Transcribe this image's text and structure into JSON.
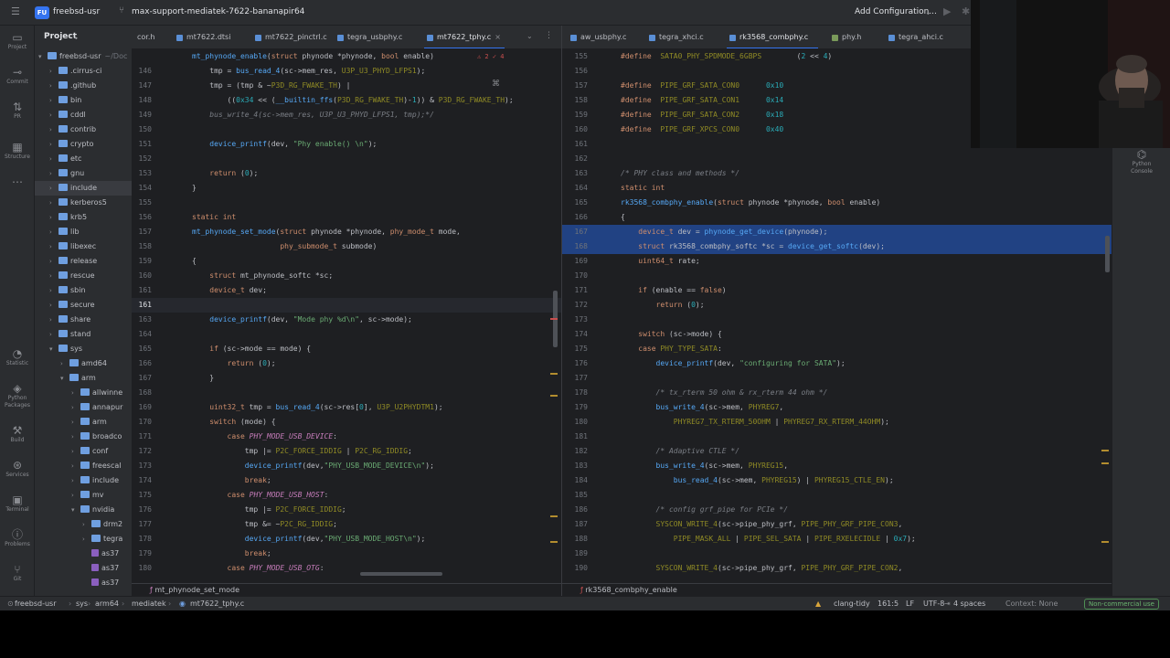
{
  "titlebar": {
    "logo": "FU",
    "project": "freebsd-usr",
    "branch": "max-support-mediatek-7622-bananapir64",
    "run_config": "Add Configuration..."
  },
  "leftstrip": {
    "items": [
      {
        "icon": "folder-icon",
        "label": "Project"
      },
      {
        "icon": "commit-icon",
        "label": "Commit"
      },
      {
        "icon": "pull-request-icon",
        "label": "PR"
      },
      {
        "icon": "structure-icon",
        "label": "Structure"
      },
      {
        "icon": "more-icon",
        "label": ""
      },
      {
        "icon": "statistic-icon",
        "label": "Statistic"
      },
      {
        "icon": "python-packages-icon",
        "label": "Python Packages"
      },
      {
        "icon": "build-icon",
        "label": "Build"
      },
      {
        "icon": "services-icon",
        "label": "Services"
      },
      {
        "icon": "terminal-icon",
        "label": "Terminal"
      },
      {
        "icon": "problems-icon",
        "label": "Problems"
      },
      {
        "icon": "git-icon",
        "label": "Git"
      }
    ]
  },
  "project_panel": {
    "title": "Project",
    "tree": [
      {
        "label": "freebsd-usr",
        "depth": 0,
        "kind": "folder",
        "open": true,
        "suffix": "~/Doc"
      },
      {
        "label": ".cirrus-ci",
        "depth": 1,
        "kind": "folder"
      },
      {
        "label": ".github",
        "depth": 1,
        "kind": "folder"
      },
      {
        "label": "bin",
        "depth": 1,
        "kind": "folder"
      },
      {
        "label": "cddl",
        "depth": 1,
        "kind": "folder"
      },
      {
        "label": "contrib",
        "depth": 1,
        "kind": "folder"
      },
      {
        "label": "crypto",
        "depth": 1,
        "kind": "folder"
      },
      {
        "label": "etc",
        "depth": 1,
        "kind": "folder"
      },
      {
        "label": "gnu",
        "depth": 1,
        "kind": "folder"
      },
      {
        "label": "include",
        "depth": 1,
        "kind": "folder",
        "selected": true
      },
      {
        "label": "kerberos5",
        "depth": 1,
        "kind": "folder"
      },
      {
        "label": "krb5",
        "depth": 1,
        "kind": "folder"
      },
      {
        "label": "lib",
        "depth": 1,
        "kind": "folder"
      },
      {
        "label": "libexec",
        "depth": 1,
        "kind": "folder"
      },
      {
        "label": "release",
        "depth": 1,
        "kind": "folder"
      },
      {
        "label": "rescue",
        "depth": 1,
        "kind": "folder"
      },
      {
        "label": "sbin",
        "depth": 1,
        "kind": "folder"
      },
      {
        "label": "secure",
        "depth": 1,
        "kind": "folder"
      },
      {
        "label": "share",
        "depth": 1,
        "kind": "folder"
      },
      {
        "label": "stand",
        "depth": 1,
        "kind": "folder"
      },
      {
        "label": "sys",
        "depth": 1,
        "kind": "folder",
        "open": true
      },
      {
        "label": "amd64",
        "depth": 2,
        "kind": "folder"
      },
      {
        "label": "arm",
        "depth": 2,
        "kind": "folder",
        "open": true
      },
      {
        "label": "allwinne",
        "depth": 3,
        "kind": "folder"
      },
      {
        "label": "annapur",
        "depth": 3,
        "kind": "folder"
      },
      {
        "label": "arm",
        "depth": 3,
        "kind": "folder"
      },
      {
        "label": "broadco",
        "depth": 3,
        "kind": "folder"
      },
      {
        "label": "conf",
        "depth": 3,
        "kind": "folder"
      },
      {
        "label": "freescal",
        "depth": 3,
        "kind": "folder"
      },
      {
        "label": "include",
        "depth": 3,
        "kind": "folder"
      },
      {
        "label": "mv",
        "depth": 3,
        "kind": "folder"
      },
      {
        "label": "nvidia",
        "depth": 3,
        "kind": "folder",
        "open": true
      },
      {
        "label": "drm2",
        "depth": 4,
        "kind": "folder"
      },
      {
        "label": "tegra",
        "depth": 4,
        "kind": "folder"
      },
      {
        "label": "as37",
        "depth": 4,
        "kind": "file"
      },
      {
        "label": "as37",
        "depth": 4,
        "kind": "file"
      },
      {
        "label": "as37",
        "depth": 4,
        "kind": "file"
      }
    ]
  },
  "left_editor": {
    "tabs": [
      {
        "label": "cor.h",
        "type": "h"
      },
      {
        "label": "mt7622.dtsi",
        "type": "c"
      },
      {
        "label": "mt7622_pinctrl.c",
        "type": "c"
      },
      {
        "label": "tegra_usbphy.c",
        "type": "c"
      },
      {
        "label": "mt7622_tphy.c",
        "type": "c",
        "active": true
      }
    ],
    "inspection": "⚠ 2 ✓ 4",
    "breadcrumb": "mt_phynode_set_mode",
    "lines": [
      {
        "n": "",
        "t": "mt_phynode_enable(struct phynode *phynode, bool enable)"
      },
      {
        "n": "146",
        "t": "    tmp = bus_read_4(sc->mem_res, U3P_U3_PHYD_LFPS1);"
      },
      {
        "n": "147",
        "t": "    tmp = (tmp & ~P3D_RG_FWAKE_TH) |"
      },
      {
        "n": "148",
        "t": "        ((0x34 << (__builtin_ffs(P3D_RG_FWAKE_TH)-1)) & P3D_RG_FWAKE_TH);"
      },
      {
        "n": "149",
        "t": "    bus_write_4(sc->mem_res, U3P_U3_PHYD_LFPS1, tmp);*/"
      },
      {
        "n": "150",
        "t": ""
      },
      {
        "n": "151",
        "t": "    device_printf(dev, \"Phy enable() \\n\");"
      },
      {
        "n": "152",
        "t": ""
      },
      {
        "n": "153",
        "t": "    return (0);"
      },
      {
        "n": "154",
        "t": "}"
      },
      {
        "n": "155",
        "t": ""
      },
      {
        "n": "156",
        "t": "static int"
      },
      {
        "n": "157",
        "t": "mt_phynode_set_mode(struct phynode *phynode, phy_mode_t mode,"
      },
      {
        "n": "158",
        "t": "                    phy_submode_t submode)"
      },
      {
        "n": "159",
        "t": "{"
      },
      {
        "n": "160",
        "t": "    struct mt_phynode_softc *sc;"
      },
      {
        "n": "161",
        "t": "    device_t dev;"
      },
      {
        "n": "161",
        "t": "    "
      },
      {
        "n": "163",
        "t": "    device_printf(dev, \"Mode phy %d\\n\", sc->mode);"
      },
      {
        "n": "164",
        "t": ""
      },
      {
        "n": "165",
        "t": "    if (sc->mode == mode) {"
      },
      {
        "n": "166",
        "t": "        return (0);"
      },
      {
        "n": "167",
        "t": "    }"
      },
      {
        "n": "168",
        "t": ""
      },
      {
        "n": "169",
        "t": "    uint32_t tmp = bus_read_4(sc->res[0], U3P_U2PHYDTM1);"
      },
      {
        "n": "170",
        "t": "    switch (mode) {"
      },
      {
        "n": "171",
        "t": "        case PHY_MODE_USB_DEVICE:"
      },
      {
        "n": "172",
        "t": "            tmp |= P2C_FORCE_IDDIG | P2C_RG_IDDIG;"
      },
      {
        "n": "173",
        "t": "            device_printf(dev,\"PHY_USB_MODE_DEVICE\\n\");"
      },
      {
        "n": "174",
        "t": "            break;"
      },
      {
        "n": "175",
        "t": "        case PHY_MODE_USB_HOST:"
      },
      {
        "n": "176",
        "t": "            tmp |= P2C_FORCE_IDDIG;"
      },
      {
        "n": "177",
        "t": "            tmp &= ~P2C_RG_IDDIG;"
      },
      {
        "n": "178",
        "t": "            device_printf(dev,\"PHY_USB_MODE_HOST\\n\");"
      },
      {
        "n": "179",
        "t": "            break;"
      },
      {
        "n": "180",
        "t": "        case PHY_MODE_USB_OTG:"
      }
    ]
  },
  "right_editor": {
    "tabs": [
      {
        "label": "aw_usbphy.c",
        "type": "c"
      },
      {
        "label": "tegra_xhci.c",
        "type": "c"
      },
      {
        "label": "rk3568_combphy.c",
        "type": "c",
        "active": true
      },
      {
        "label": "phy.h",
        "type": "h"
      },
      {
        "label": "tegra_ahci.c",
        "type": "c"
      }
    ],
    "breadcrumb": "rk3568_combphy_enable",
    "lines": [
      {
        "n": "155",
        "t": "#define  SATA0_PHY_SPDMODE_6GBPS        (2 << 4)"
      },
      {
        "n": "156",
        "t": ""
      },
      {
        "n": "157",
        "t": "#define  PIPE_GRF_SATA_CON0      0x10"
      },
      {
        "n": "158",
        "t": "#define  PIPE_GRF_SATA_CON1      0x14"
      },
      {
        "n": "159",
        "t": "#define  PIPE_GRF_SATA_CON2      0x18"
      },
      {
        "n": "160",
        "t": "#define  PIPE_GRF_XPCS_CON0      0x40"
      },
      {
        "n": "161",
        "t": ""
      },
      {
        "n": "162",
        "t": ""
      },
      {
        "n": "163",
        "t": "/* PHY class and methods */"
      },
      {
        "n": "164",
        "t": "static int"
      },
      {
        "n": "165",
        "t": "rk3568_combphy_enable(struct phynode *phynode, bool enable)"
      },
      {
        "n": "166",
        "t": "{"
      },
      {
        "n": "167",
        "t": "    device_t dev = phynode_get_device(phynode);",
        "hl": true
      },
      {
        "n": "168",
        "t": "    struct rk3568_combphy_softc *sc = device_get_softc(dev);",
        "hl": true
      },
      {
        "n": "169",
        "t": "    uint64_t rate;"
      },
      {
        "n": "170",
        "t": ""
      },
      {
        "n": "171",
        "t": "    if (enable == false)"
      },
      {
        "n": "172",
        "t": "        return (0);"
      },
      {
        "n": "173",
        "t": ""
      },
      {
        "n": "174",
        "t": "    switch (sc->mode) {"
      },
      {
        "n": "175",
        "t": "    case PHY_TYPE_SATA:"
      },
      {
        "n": "176",
        "t": "        device_printf(dev, \"configuring for SATA\");"
      },
      {
        "n": "177",
        "t": ""
      },
      {
        "n": "178",
        "t": "        /* tx_rterm 50 ohm & rx_rterm 44 ohm */"
      },
      {
        "n": "179",
        "t": "        bus_write_4(sc->mem, PHYREG7,"
      },
      {
        "n": "180",
        "t": "            PHYREG7_TX_RTERM_50OHM | PHYREG7_RX_RTERM_44OHM);"
      },
      {
        "n": "181",
        "t": ""
      },
      {
        "n": "182",
        "t": "        /* Adaptive CTLE */"
      },
      {
        "n": "183",
        "t": "        bus_write_4(sc->mem, PHYREG15,"
      },
      {
        "n": "184",
        "t": "            bus_read_4(sc->mem, PHYREG15) | PHYREG15_CTLE_EN);"
      },
      {
        "n": "185",
        "t": ""
      },
      {
        "n": "186",
        "t": "        /* config grf_pipe for PCIe */"
      },
      {
        "n": "187",
        "t": "        SYSCON_WRITE_4(sc->pipe_phy_grf, PIPE_PHY_GRF_PIPE_CON3,"
      },
      {
        "n": "188",
        "t": "            PIPE_MASK_ALL | PIPE_SEL_SATA | PIPE_RXELECIDLE | 0x7);"
      },
      {
        "n": "189",
        "t": ""
      },
      {
        "n": "190",
        "t": "        SYSCON_WRITE_4(sc->pipe_phy_grf, PIPE_PHY_GRF_PIPE_CON2,"
      }
    ]
  },
  "rightstrip": {
    "python_console": "Python Console"
  },
  "statusbar": {
    "path": [
      "freebsd-usr",
      "sys",
      "arm64",
      "mediatek",
      "mt7622_tphy.c"
    ],
    "linter": "clang-tidy",
    "position": "161:5",
    "line_ending": "LF",
    "encoding": "UTF-8",
    "indent": "4 spaces",
    "context": "Context: None",
    "license": "Non-commercial use"
  }
}
